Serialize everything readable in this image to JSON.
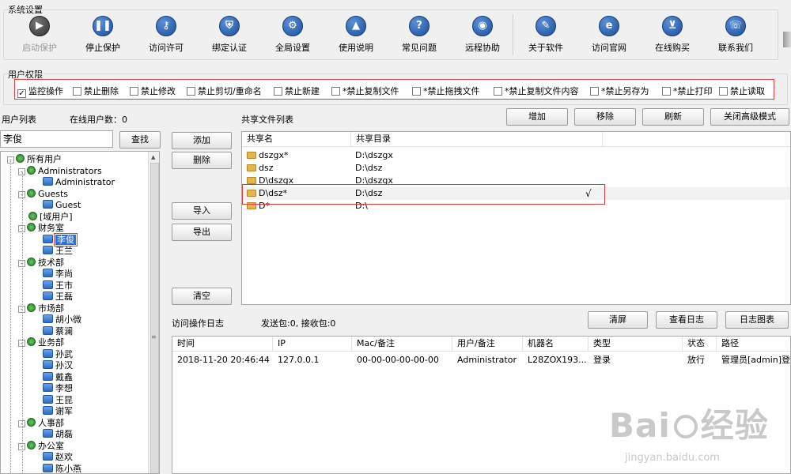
{
  "section_titles": {
    "system_settings": "系统设置",
    "user_permissions": "用户权限",
    "user_list": "用户列表",
    "shared_file_list": "共享文件列表",
    "access_log": "访问操作日志"
  },
  "toolbar": [
    {
      "label": "启动保护",
      "icon": "play-icon",
      "disabled": true
    },
    {
      "label": "停止保护",
      "icon": "pause-icon"
    },
    {
      "label": "访问许可",
      "icon": "key-icon"
    },
    {
      "label": "绑定认证",
      "icon": "shield-icon"
    },
    {
      "label": "全局设置",
      "icon": "gear-icon"
    },
    {
      "label": "使用说明",
      "icon": "graduation-cap-icon"
    },
    {
      "label": "常见问题",
      "icon": "question-icon"
    },
    {
      "label": "远程协助",
      "icon": "globe-icon"
    },
    {
      "label": "关于软件",
      "icon": "edit-icon"
    },
    {
      "label": "访问官网",
      "icon": "ie-icon"
    },
    {
      "label": "在线购买",
      "icon": "cart-icon"
    },
    {
      "label": "联系我们",
      "icon": "phone-icon"
    }
  ],
  "permissions": [
    {
      "label": "监控操作",
      "checked": true
    },
    {
      "label": "禁止删除",
      "checked": false
    },
    {
      "label": "禁止修改",
      "checked": false
    },
    {
      "label": "禁止剪切/重命名",
      "checked": false
    },
    {
      "label": "禁止新建",
      "checked": false
    },
    {
      "label": "*禁止复制文件",
      "checked": false
    },
    {
      "label": "*禁止拖拽文件",
      "checked": false
    },
    {
      "label": "*禁止复制文件内容",
      "checked": false
    },
    {
      "label": "*禁止另存为",
      "checked": false
    },
    {
      "label": "*禁止打印",
      "checked": false
    },
    {
      "label": "禁止读取",
      "checked": false
    }
  ],
  "online_users": "在线用户数：0",
  "search": {
    "value": "李俊",
    "button": "查找"
  },
  "user_buttons": {
    "add": "添加",
    "delete": "删除",
    "import": "导入",
    "export": "导出",
    "clear": "清空"
  },
  "tree": [
    {
      "label": "所有用户",
      "level": 0,
      "type": "net",
      "expander": "-"
    },
    {
      "label": "Administrators",
      "level": 1,
      "type": "net",
      "expander": "-"
    },
    {
      "label": "Administrator",
      "level": 2,
      "type": "user"
    },
    {
      "label": "Guests",
      "level": 1,
      "type": "net",
      "expander": "-"
    },
    {
      "label": "Guest",
      "level": 2,
      "type": "user"
    },
    {
      "label": "[域用户]",
      "level": 1,
      "type": "net"
    },
    {
      "label": "财务室",
      "level": 1,
      "type": "net",
      "expander": "-"
    },
    {
      "label": "李俊",
      "level": 2,
      "type": "user",
      "selected": true
    },
    {
      "label": "王兰",
      "level": 2,
      "type": "user"
    },
    {
      "label": "技术部",
      "level": 1,
      "type": "net",
      "expander": "-"
    },
    {
      "label": "李尚",
      "level": 2,
      "type": "user"
    },
    {
      "label": "王市",
      "level": 2,
      "type": "user"
    },
    {
      "label": "王磊",
      "level": 2,
      "type": "user"
    },
    {
      "label": "市场部",
      "level": 1,
      "type": "net",
      "expander": "-"
    },
    {
      "label": "胡小微",
      "level": 2,
      "type": "user"
    },
    {
      "label": "蔡澜",
      "level": 2,
      "type": "user"
    },
    {
      "label": "业务部",
      "level": 1,
      "type": "net",
      "expander": "-"
    },
    {
      "label": "孙武",
      "level": 2,
      "type": "user"
    },
    {
      "label": "孙汉",
      "level": 2,
      "type": "user"
    },
    {
      "label": "戴鑫",
      "level": 2,
      "type": "user"
    },
    {
      "label": "李想",
      "level": 2,
      "type": "user"
    },
    {
      "label": "王昆",
      "level": 2,
      "type": "user"
    },
    {
      "label": "谢军",
      "level": 2,
      "type": "user"
    },
    {
      "label": "人事部",
      "level": 1,
      "type": "net",
      "expander": "-"
    },
    {
      "label": "胡磊",
      "level": 2,
      "type": "user"
    },
    {
      "label": "办公室",
      "level": 1,
      "type": "net",
      "expander": "-"
    },
    {
      "label": "赵欢",
      "level": 2,
      "type": "user"
    },
    {
      "label": "陈小燕",
      "level": 2,
      "type": "user"
    }
  ],
  "share_buttons": {
    "add": "增加",
    "remove": "移除",
    "refresh": "刷新",
    "close_advanced": "关闭高级模式"
  },
  "share_columns": [
    "共享名",
    "共享目录"
  ],
  "shares": [
    {
      "name": "dszgx*",
      "dir": "D:\\dszgx",
      "mark": ""
    },
    {
      "name": "dsz",
      "dir": "D:\\dsz",
      "mark": ""
    },
    {
      "name": "D\\dszgx",
      "dir": "D:\\dszgx",
      "mark": ""
    },
    {
      "name": "D\\dsz*",
      "dir": "D:\\dsz",
      "mark": "√",
      "selected": true
    },
    {
      "name": "D*",
      "dir": "D:\\",
      "mark": ""
    }
  ],
  "packets": "发送包:0, 接收包:0",
  "log_buttons": {
    "clear_screen": "清屏",
    "view_log": "查看日志",
    "log_chart": "日志图表"
  },
  "log_columns": [
    "时间",
    "IP",
    "Mac/备注",
    "用户/备注",
    "机器名",
    "类型",
    "状态",
    "路径"
  ],
  "logs": [
    [
      "2018-11-20 20:46:44",
      "127.0.0.1",
      "00-00-00-00-00-00",
      "Administrator",
      "L28ZOX193...",
      "登录",
      "放行",
      "管理员[admin]登录"
    ]
  ],
  "watermark": {
    "brand": "Bai",
    "brand2": "经验",
    "url": "jingyan.baidu.com"
  }
}
